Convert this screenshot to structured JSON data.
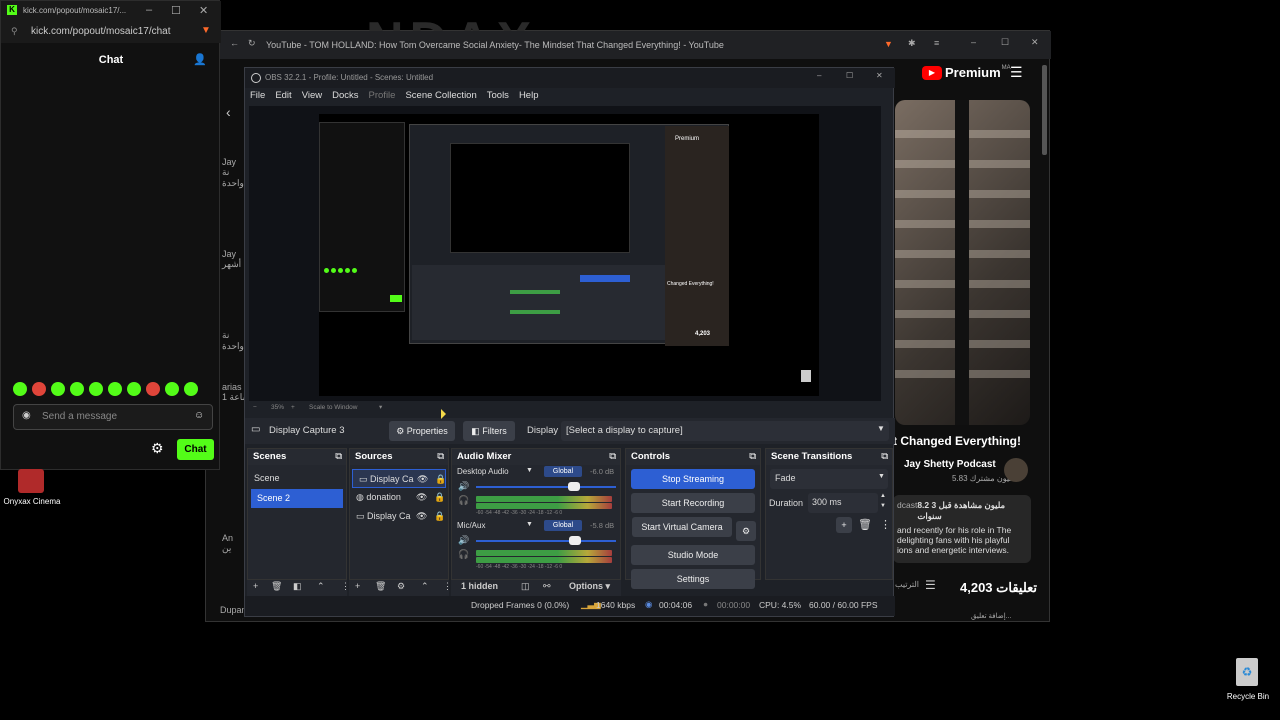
{
  "kick": {
    "url": "kick.com/popout/mosaic17/chat",
    "url_short": "kick.com/popout/mosaic17/...",
    "chat_title": "Chat",
    "send_placeholder": "Send a message",
    "chat_button": "Chat"
  },
  "youtube": {
    "tab_title": "YouTube - TOM HOLLAND: How Tom Overcame Social Anxiety- The Mindset That Changed Everything! - YouTube",
    "premium": "Premium",
    "premium_badge": "MA",
    "video_title": "t Changed Everything!",
    "channel": "Jay Shetty Podcast",
    "subscribers": "5.83 مليون مشترك",
    "views": "8.2 مليون مشاهدة قبل 3 سنوات",
    "desc_lines": [
      "and recently for his role in The",
      "delighting fans with his playful",
      "ions and energetic interviews."
    ],
    "desc_prefix": "dcast",
    "comments": "4,203 تعليقات",
    "sort": "الترتيب",
    "add_comment": "إضافة تعليق...",
    "big_text": "NDAX",
    "side_texts": [
      "Jay",
      "نة واحدة",
      "Jay",
      "أشهر",
      "نة واحدة",
      "arias",
      "1 ساعة",
      "An",
      "ين"
    ],
    "bottom_user": "Dupamicamerie"
  },
  "obs": {
    "title": "OBS 32.2.1 - Profile: Untitled - Scenes: Untitled",
    "menu": [
      "File",
      "Edit",
      "View",
      "Docks",
      "Profile",
      "Scene Collection",
      "Tools",
      "Help"
    ],
    "zoom": "35%",
    "scale": "Scale to Window",
    "context": {
      "source": "Display Capture 3",
      "properties": "Properties",
      "filters": "Filters",
      "display_label": "Display",
      "display_value": "[Select a display to capture]"
    },
    "scenes": {
      "title": "Scenes",
      "items": [
        "Scene",
        "Scene 2"
      ]
    },
    "sources": {
      "title": "Sources",
      "items": [
        "Display Ca",
        "donation",
        "Display Ca"
      ],
      "hidden": "1 hidden"
    },
    "mixer": {
      "title": "Audio Mixer",
      "channels": [
        {
          "name": "Desktop Audio",
          "badge": "Global",
          "db": "-6.0 dB"
        },
        {
          "name": "Mic/Aux",
          "badge": "Global",
          "db": "-5.8 dB"
        }
      ],
      "ticks": "-60 -54 -48 -42 -36 -30 -24 -18 -12 -6 0",
      "options": "Options"
    },
    "controls": {
      "title": "Controls",
      "buttons": [
        "Stop Streaming",
        "Start Recording",
        "Start Virtual Camera",
        "Studio Mode",
        "Settings"
      ]
    },
    "transitions": {
      "title": "Scene Transitions",
      "type": "Fade",
      "duration_label": "Duration",
      "duration_value": "300 ms"
    },
    "status": {
      "dropped": "Dropped Frames 0 (0.0%)",
      "kbps": "1640 kbps",
      "stream_time": "00:04:06",
      "rec_time": "00:00:00",
      "cpu": "CPU: 4.5%",
      "fps": "60.00 / 60.00 FPS"
    }
  },
  "desktop": {
    "onyx": "Onyxax Cinema",
    "recycle": "Recycle Bin"
  },
  "colors": {
    "kick_green": "#53fc18",
    "obs_blue": "#2d5fd3",
    "yt_red": "#ff0000"
  }
}
